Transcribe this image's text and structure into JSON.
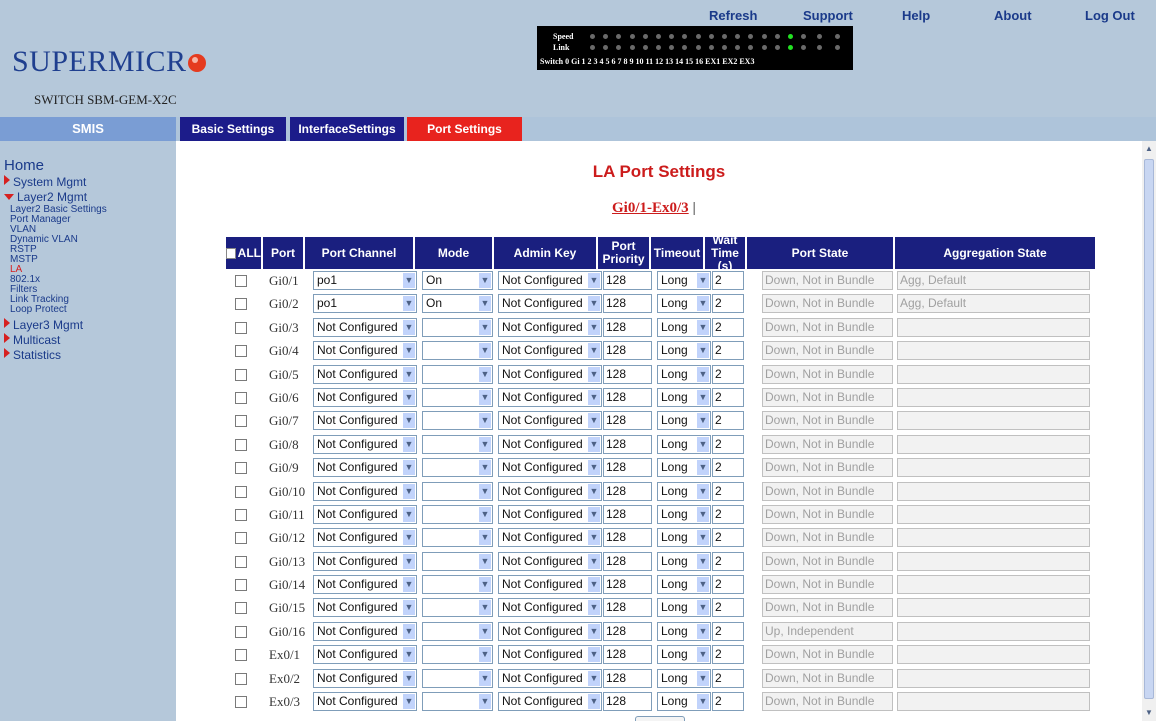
{
  "top_nav": [
    "Refresh",
    "Support",
    "Help",
    "About",
    "Log Out"
  ],
  "brand": {
    "logo_text": "SUPERMICR",
    "model": "SWITCH SBM-GEM-X2C",
    "logo_dot_color": "#e53b1f"
  },
  "led_panel": {
    "speed_label": "Speed",
    "link_label": "Link",
    "numbers": "Switch 0 Gi 1 2 3 4 5 6 7 8 9 10 11 12 13 14 15 16 EX1 EX2 EX3",
    "active_led": "16"
  },
  "tabs": [
    "SMIS",
    "Basic Settings",
    "InterfaceSettings",
    "Port Settings"
  ],
  "sidebar": {
    "home": "Home",
    "items": [
      {
        "label": "System Mgmt",
        "state": "collapsed"
      },
      {
        "label": "Layer2 Mgmt",
        "state": "expanded"
      },
      {
        "label": "Layer3 Mgmt",
        "state": "collapsed"
      },
      {
        "label": "Multicast",
        "state": "collapsed"
      },
      {
        "label": "Statistics",
        "state": "collapsed"
      }
    ],
    "layer2_sub": [
      "Layer2 Basic Settings",
      "Port Manager",
      "VLAN",
      "Dynamic VLAN",
      "RSTP",
      "MSTP",
      "LA",
      "802.1x",
      "Filters",
      "Link Tracking",
      "Loop Protect"
    ],
    "active_sub": "LA"
  },
  "page": {
    "title": "LA Port Settings",
    "range_link": "Gi0/1-Ex0/3",
    "range_sep": "|"
  },
  "table": {
    "all_label": "ALL",
    "headers": [
      "Port",
      "Port Channel",
      "Mode",
      "Admin Key",
      "Port Priority",
      "Timeout",
      "Wait Time (s)",
      "Port State",
      "Aggregation State"
    ],
    "rows": [
      {
        "port": "Gi0/1",
        "channel": "po1",
        "mode": "On",
        "admin_key": "Not Configured",
        "priority": "128",
        "timeout": "Long",
        "wait": "2",
        "port_state": "Down, Not in Bundle",
        "agg_state": "Agg, Default"
      },
      {
        "port": "Gi0/2",
        "channel": "po1",
        "mode": "On",
        "admin_key": "Not Configured",
        "priority": "128",
        "timeout": "Long",
        "wait": "2",
        "port_state": "Down, Not in Bundle",
        "agg_state": "Agg, Default"
      },
      {
        "port": "Gi0/3",
        "channel": "Not Configured",
        "mode": "",
        "admin_key": "Not Configured",
        "priority": "128",
        "timeout": "Long",
        "wait": "2",
        "port_state": "Down, Not in Bundle",
        "agg_state": ""
      },
      {
        "port": "Gi0/4",
        "channel": "Not Configured",
        "mode": "",
        "admin_key": "Not Configured",
        "priority": "128",
        "timeout": "Long",
        "wait": "2",
        "port_state": "Down, Not in Bundle",
        "agg_state": ""
      },
      {
        "port": "Gi0/5",
        "channel": "Not Configured",
        "mode": "",
        "admin_key": "Not Configured",
        "priority": "128",
        "timeout": "Long",
        "wait": "2",
        "port_state": "Down, Not in Bundle",
        "agg_state": ""
      },
      {
        "port": "Gi0/6",
        "channel": "Not Configured",
        "mode": "",
        "admin_key": "Not Configured",
        "priority": "128",
        "timeout": "Long",
        "wait": "2",
        "port_state": "Down, Not in Bundle",
        "agg_state": ""
      },
      {
        "port": "Gi0/7",
        "channel": "Not Configured",
        "mode": "",
        "admin_key": "Not Configured",
        "priority": "128",
        "timeout": "Long",
        "wait": "2",
        "port_state": "Down, Not in Bundle",
        "agg_state": ""
      },
      {
        "port": "Gi0/8",
        "channel": "Not Configured",
        "mode": "",
        "admin_key": "Not Configured",
        "priority": "128",
        "timeout": "Long",
        "wait": "2",
        "port_state": "Down, Not in Bundle",
        "agg_state": ""
      },
      {
        "port": "Gi0/9",
        "channel": "Not Configured",
        "mode": "",
        "admin_key": "Not Configured",
        "priority": "128",
        "timeout": "Long",
        "wait": "2",
        "port_state": "Down, Not in Bundle",
        "agg_state": ""
      },
      {
        "port": "Gi0/10",
        "channel": "Not Configured",
        "mode": "",
        "admin_key": "Not Configured",
        "priority": "128",
        "timeout": "Long",
        "wait": "2",
        "port_state": "Down, Not in Bundle",
        "agg_state": ""
      },
      {
        "port": "Gi0/11",
        "channel": "Not Configured",
        "mode": "",
        "admin_key": "Not Configured",
        "priority": "128",
        "timeout": "Long",
        "wait": "2",
        "port_state": "Down, Not in Bundle",
        "agg_state": ""
      },
      {
        "port": "Gi0/12",
        "channel": "Not Configured",
        "mode": "",
        "admin_key": "Not Configured",
        "priority": "128",
        "timeout": "Long",
        "wait": "2",
        "port_state": "Down, Not in Bundle",
        "agg_state": ""
      },
      {
        "port": "Gi0/13",
        "channel": "Not Configured",
        "mode": "",
        "admin_key": "Not Configured",
        "priority": "128",
        "timeout": "Long",
        "wait": "2",
        "port_state": "Down, Not in Bundle",
        "agg_state": ""
      },
      {
        "port": "Gi0/14",
        "channel": "Not Configured",
        "mode": "",
        "admin_key": "Not Configured",
        "priority": "128",
        "timeout": "Long",
        "wait": "2",
        "port_state": "Down, Not in Bundle",
        "agg_state": ""
      },
      {
        "port": "Gi0/15",
        "channel": "Not Configured",
        "mode": "",
        "admin_key": "Not Configured",
        "priority": "128",
        "timeout": "Long",
        "wait": "2",
        "port_state": "Down, Not in Bundle",
        "agg_state": ""
      },
      {
        "port": "Gi0/16",
        "channel": "Not Configured",
        "mode": "",
        "admin_key": "Not Configured",
        "priority": "128",
        "timeout": "Long",
        "wait": "2",
        "port_state": "Up, Independent",
        "agg_state": ""
      },
      {
        "port": "Ex0/1",
        "channel": "Not Configured",
        "mode": "",
        "admin_key": "Not Configured",
        "priority": "128",
        "timeout": "Long",
        "wait": "2",
        "port_state": "Down, Not in Bundle",
        "agg_state": ""
      },
      {
        "port": "Ex0/2",
        "channel": "Not Configured",
        "mode": "",
        "admin_key": "Not Configured",
        "priority": "128",
        "timeout": "Long",
        "wait": "2",
        "port_state": "Down, Not in Bundle",
        "agg_state": ""
      },
      {
        "port": "Ex0/3",
        "channel": "Not Configured",
        "mode": "",
        "admin_key": "Not Configured",
        "priority": "128",
        "timeout": "Long",
        "wait": "2",
        "port_state": "Down, Not in Bundle",
        "agg_state": ""
      }
    ]
  },
  "icons": {
    "dropdown": "chevron-down-icon",
    "expand": "triangle-right-icon",
    "collapse": "triangle-down-icon"
  }
}
